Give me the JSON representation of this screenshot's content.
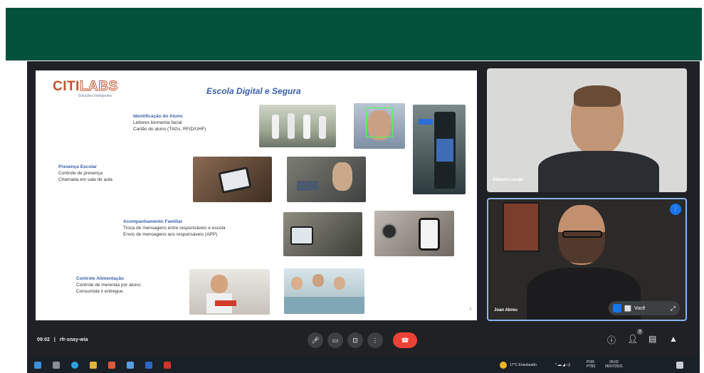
{
  "meeting": {
    "time": "09:02",
    "separator": "|",
    "code": "rfr-snay-wia"
  },
  "slide": {
    "logo_part1": "CITI",
    "logo_part2": "LABS",
    "logo_sub": "Soluções Inteligentes",
    "title": "Escola Digital e Segura",
    "page_number": "4",
    "sections": [
      {
        "heading": "Identificação do Aluno",
        "lines": [
          "Leitores biometria facial",
          "Cartão do aluno (TAGs, RFID/UHF)"
        ]
      },
      {
        "heading": "Presença Escolar",
        "lines": [
          "Controle de presença",
          "Chamada em sala de aula"
        ]
      },
      {
        "heading": "Acompanhamento Familiar",
        "lines": [
          "Troca de mensagens entre responsáveis e escola",
          "Envio de mensagens aos responsáveis (APP)"
        ]
      },
      {
        "heading": "Controle Alimentação",
        "lines": [
          "Controle de merenda por aluno;",
          "Consumida x entregue."
        ]
      }
    ]
  },
  "participants": [
    {
      "name": "Adilson Lucato"
    },
    {
      "name": "Joan Abreu",
      "pin_label": "Você"
    }
  ],
  "tray": {
    "weather": "17°C Ensolarado",
    "lang": "POR",
    "lang2": "PTB2",
    "clock": "09:02",
    "date": "06/07/2021"
  },
  "colors": {
    "banner": "#03513a",
    "meet_bg": "#202124",
    "end_call": "#ea4335",
    "accent_blue": "#1a73e8",
    "slide_title": "#3a5fae",
    "logo": "#c4502a"
  },
  "icons": {
    "controls": [
      "microphone-icon",
      "camera-icon",
      "present-screen-icon",
      "more-options-icon",
      "end-call-icon"
    ],
    "right_controls": [
      "info-icon",
      "people-icon",
      "chat-icon",
      "activities-icon"
    ],
    "participant_count": "3"
  }
}
